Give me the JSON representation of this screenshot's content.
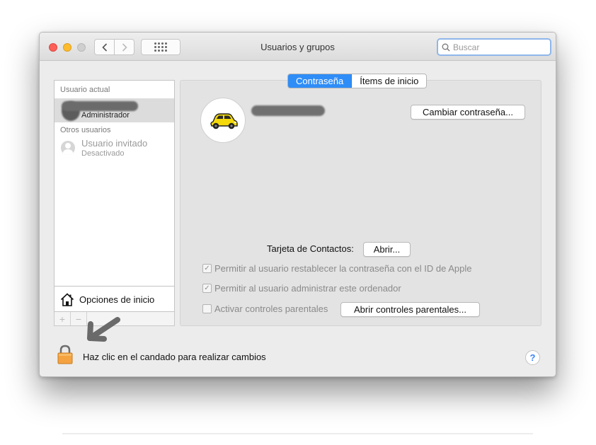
{
  "window": {
    "title": "Usuarios y grupos",
    "search_placeholder": "Buscar"
  },
  "sidebar": {
    "current_user_header": "Usuario actual",
    "current_user_role": "Administrador",
    "other_users_header": "Otros usuarios",
    "guest_name": "Usuario invitado",
    "guest_status": "Desactivado",
    "login_options_label": "Opciones de inicio",
    "add_label": "+",
    "remove_label": "−"
  },
  "tabs": [
    {
      "label": "Contraseña",
      "active": true
    },
    {
      "label": "Ítems de inicio",
      "active": false
    }
  ],
  "panel": {
    "change_password_button": "Cambiar contraseña...",
    "contact_card_label": "Tarjeta de Contactos:",
    "open_button": "Abrir...",
    "checkbox_reset_password": {
      "label": "Permitir al usuario restablecer la contraseña con el ID de Apple",
      "checked": true
    },
    "checkbox_admin": {
      "label": "Permitir al usuario administrar este ordenador",
      "checked": true
    },
    "checkbox_parental": {
      "label": "Activar controles parentales",
      "checked": false
    },
    "open_parental_button": "Abrir controles parentales..."
  },
  "footer": {
    "lock_text": "Haz clic en el candado para realizar cambios",
    "help_label": "?"
  },
  "icons": {
    "avatar": "yellow-car-icon",
    "lock": "lock-icon",
    "home": "home-icon",
    "arrow": "annotation-arrow-icon"
  },
  "colors": {
    "accent": "#2f8df7",
    "lock": "#f4a340",
    "car": "#f5d90a"
  }
}
